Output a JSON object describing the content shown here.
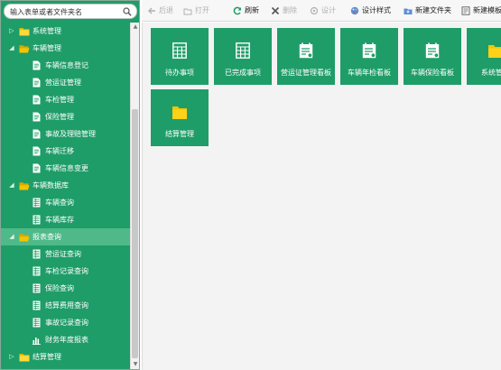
{
  "search": {
    "placeholder": "输入表单或者文件夹名"
  },
  "tree": [
    {
      "label": "系统管理",
      "level": 1,
      "type": "folder",
      "expanded": false
    },
    {
      "label": "车辆管理",
      "level": 1,
      "type": "folder",
      "expanded": true
    },
    {
      "label": "车辆信息登记",
      "level": 2,
      "type": "form"
    },
    {
      "label": "营运证管理",
      "level": 2,
      "type": "form"
    },
    {
      "label": "车检管理",
      "level": 2,
      "type": "form"
    },
    {
      "label": "保险管理",
      "level": 2,
      "type": "form"
    },
    {
      "label": "事故及理赔管理",
      "level": 2,
      "type": "form"
    },
    {
      "label": "车辆迁移",
      "level": 2,
      "type": "form"
    },
    {
      "label": "车辆信息变更",
      "level": 2,
      "type": "form"
    },
    {
      "label": "车辆数据库",
      "level": 1,
      "type": "folder",
      "expanded": true
    },
    {
      "label": "车辆查询",
      "level": 2,
      "type": "report"
    },
    {
      "label": "车辆库存",
      "level": 2,
      "type": "report"
    },
    {
      "label": "报表查询",
      "level": 1,
      "type": "folder",
      "expanded": true,
      "selected": true
    },
    {
      "label": "营运证查询",
      "level": 2,
      "type": "report"
    },
    {
      "label": "车检记录查询",
      "level": 2,
      "type": "report"
    },
    {
      "label": "保险查询",
      "level": 2,
      "type": "report"
    },
    {
      "label": "结算费用查询",
      "level": 2,
      "type": "report"
    },
    {
      "label": "事故记录查询",
      "level": 2,
      "type": "report"
    },
    {
      "label": "财务年度报表",
      "level": 2,
      "type": "chart"
    },
    {
      "label": "结算管理",
      "level": 1,
      "type": "folder",
      "expanded": false
    }
  ],
  "toolbar": {
    "back": "后退",
    "open": "打开",
    "refresh": "刷新",
    "delete": "删除",
    "design": "设计",
    "design_style": "设计样式",
    "new_folder": "新建文件夹",
    "new_template": "新建模板"
  },
  "tiles": [
    {
      "label": "待办事项",
      "icon": "grid-icon"
    },
    {
      "label": "已完成事项",
      "icon": "grid-icon"
    },
    {
      "label": "营运证管理看板",
      "icon": "dashboard-icon"
    },
    {
      "label": "车辆年检看板",
      "icon": "dashboard-icon"
    },
    {
      "label": "车辆保险看板",
      "icon": "dashboard-icon"
    },
    {
      "label": "系统管理",
      "icon": "folder-icon"
    },
    {
      "label": "结算管理",
      "icon": "folder-icon"
    }
  ],
  "colors": {
    "sidebar": "#1f9d68",
    "selected": "#4fb98a",
    "folder": "#f5c400",
    "tile": "#1f9d68"
  }
}
